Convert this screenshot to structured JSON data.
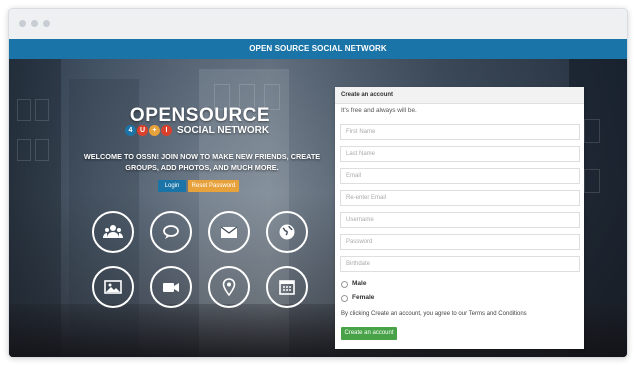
{
  "app": {
    "title": "OPEN SOURCE SOCIAL NETWORK"
  },
  "hero": {
    "logo_main": "OPENSOURCE",
    "logo_badges": [
      "4",
      "U",
      "+",
      "I"
    ],
    "logo_sub": "SOCIAL NETWORK",
    "welcome_text": "WELCOME TO OSSN! JOIN NOW TO MAKE NEW FRIENDS, CREATE GROUPS, ADD PHOTOS, AND MUCH MORE.",
    "login_label": "Login",
    "reset_label": "Reset Password",
    "feature_icons": [
      "users-icon",
      "chat-icon",
      "mail-icon",
      "globe-icon",
      "photo-icon",
      "video-icon",
      "location-icon",
      "calendar-icon"
    ]
  },
  "signup": {
    "title": "Create an account",
    "subtitle": "It's free and always will be.",
    "fields": {
      "first_name": "First Name",
      "last_name": "Last Name",
      "email": "Email",
      "reenter_email": "Re-enter Email",
      "username": "Username",
      "password": "Password",
      "birthdate": "Birthdate"
    },
    "gender_male": "Male",
    "gender_female": "Female",
    "terms": "By clicking Create an account, you agree to our Terms and Conditions",
    "submit_label": "Create an account"
  },
  "colors": {
    "primary": "#1b74a8",
    "reset": "#e8a23c",
    "submit": "#48a348"
  }
}
